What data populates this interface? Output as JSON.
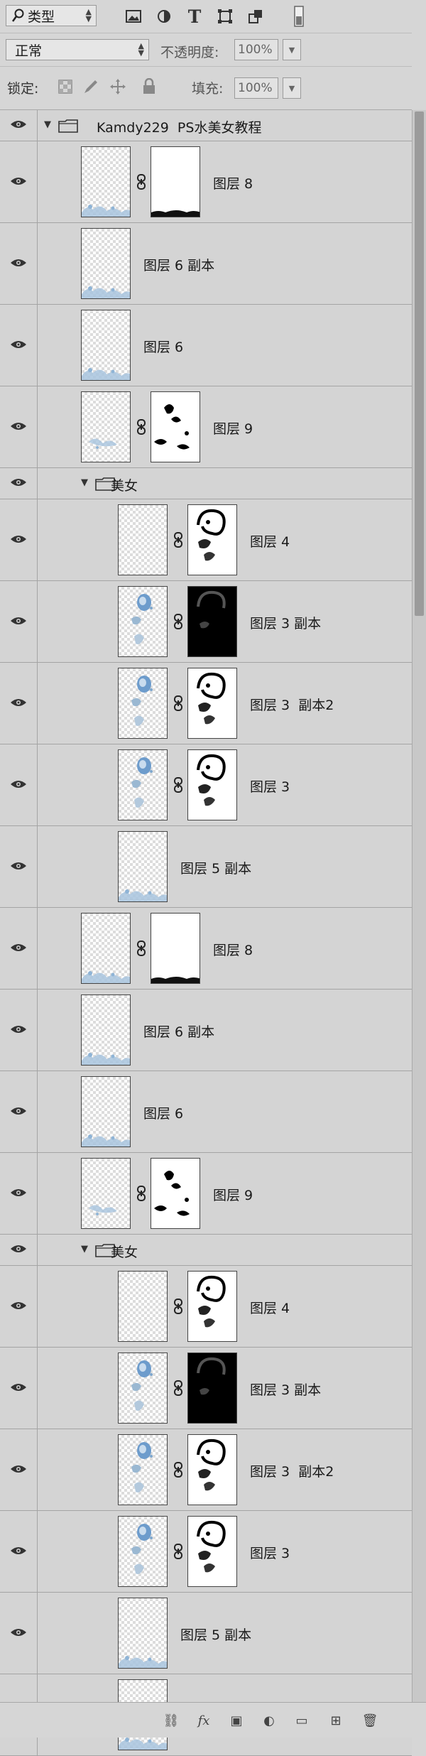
{
  "filter": {
    "kind_label": "类型"
  },
  "blend": {
    "mode": "正常",
    "opacity_label": "不透明度:",
    "opacity_value": "100%"
  },
  "lock": {
    "label": "锁定:",
    "fill_label": "填充:",
    "fill_value": "100%"
  },
  "icons": {
    "search": "search-icon",
    "image_filter": "image-filter-icon",
    "adjust_filter": "adjustment-filter-icon",
    "type_filter": "type-filter-icon",
    "shape_filter": "shape-filter-icon",
    "smart_filter": "smart-object-filter-icon",
    "filter_toggle": "filter-toggle-icon"
  },
  "layers": [
    {
      "kind": "group",
      "name": "Kamdy229  PS水美女教程",
      "indent": 0
    },
    {
      "kind": "layer",
      "name": "图层 8",
      "indent": 0,
      "mask": "white-bottom",
      "content": "bottom-splash"
    },
    {
      "kind": "layer",
      "name": "图层 6 副本",
      "indent": 0,
      "mask": null,
      "content": "bottom-splash"
    },
    {
      "kind": "layer",
      "name": "图层 6",
      "indent": 0,
      "mask": null,
      "content": "bottom-splash"
    },
    {
      "kind": "layer",
      "name": "图层 9",
      "indent": 0,
      "mask": "blots",
      "content": "mid-splash"
    },
    {
      "kind": "group",
      "name": "美女",
      "indent": 1
    },
    {
      "kind": "layer",
      "name": "图层 4",
      "indent": 1,
      "mask": "face-outline",
      "content": "empty"
    },
    {
      "kind": "layer",
      "name": "图层 3 副本",
      "indent": 1,
      "mask": "face-dark",
      "content": "face-blue"
    },
    {
      "kind": "layer",
      "name": "图层 3  副本2",
      "indent": 1,
      "mask": "face-outline",
      "content": "face-blue"
    },
    {
      "kind": "layer",
      "name": "图层 3",
      "indent": 1,
      "mask": "face-outline",
      "content": "face-blue"
    },
    {
      "kind": "layer",
      "name": "图层 5 副本",
      "indent": 1,
      "mask": null,
      "content": "bottom-splash"
    },
    {
      "kind": "layer",
      "name": "图层 8",
      "indent": 0,
      "mask": "white-bottom",
      "content": "bottom-splash"
    },
    {
      "kind": "layer",
      "name": "图层 6 副本",
      "indent": 0,
      "mask": null,
      "content": "bottom-splash"
    },
    {
      "kind": "layer",
      "name": "图层 6",
      "indent": 0,
      "mask": null,
      "content": "bottom-splash"
    },
    {
      "kind": "layer",
      "name": "图层 9",
      "indent": 0,
      "mask": "blots",
      "content": "mid-splash"
    },
    {
      "kind": "group",
      "name": "美女",
      "indent": 1
    },
    {
      "kind": "layer",
      "name": "图层 4",
      "indent": 1,
      "mask": "face-outline",
      "content": "empty"
    },
    {
      "kind": "layer",
      "name": "图层 3 副本",
      "indent": 1,
      "mask": "face-dark",
      "content": "face-blue"
    },
    {
      "kind": "layer",
      "name": "图层 3  副本2",
      "indent": 1,
      "mask": "face-outline",
      "content": "face-blue"
    },
    {
      "kind": "layer",
      "name": "图层 3",
      "indent": 1,
      "mask": "face-outline",
      "content": "face-blue"
    },
    {
      "kind": "layer",
      "name": "图层 5 副本",
      "indent": 1,
      "mask": null,
      "content": "bottom-splash"
    },
    {
      "kind": "layer",
      "name": "",
      "indent": 1,
      "mask": null,
      "content": "bottom-splash"
    }
  ],
  "footer_icons": [
    "link-layers-icon",
    "fx-icon",
    "add-mask-icon",
    "adjustment-layer-icon",
    "new-group-icon",
    "new-layer-icon",
    "delete-layer-icon"
  ],
  "colors": {
    "panel_bg": "#d6d6d6",
    "row_divider": "#a4a4a4",
    "splash_blue": "#8fb4d6"
  }
}
